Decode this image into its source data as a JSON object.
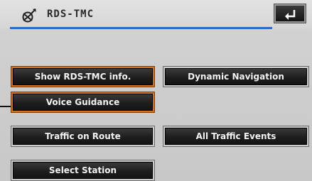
{
  "header": {
    "title": "RDS-TMC",
    "title_icon": "satellite-dish-icon",
    "back_icon": "return-arrow-icon"
  },
  "buttons": {
    "show_rds_tmc_info": "Show RDS-TMC info.",
    "dynamic_navigation": "Dynamic Navigation",
    "voice_guidance": "Voice Guidance",
    "traffic_on_route": "Traffic on Route",
    "all_traffic_events": "All Traffic Events",
    "select_station": "Select Station"
  },
  "colors": {
    "accent_line": "#2a6cc4",
    "selected_border": "#d07020",
    "button_bg": "#1e1e1e"
  }
}
